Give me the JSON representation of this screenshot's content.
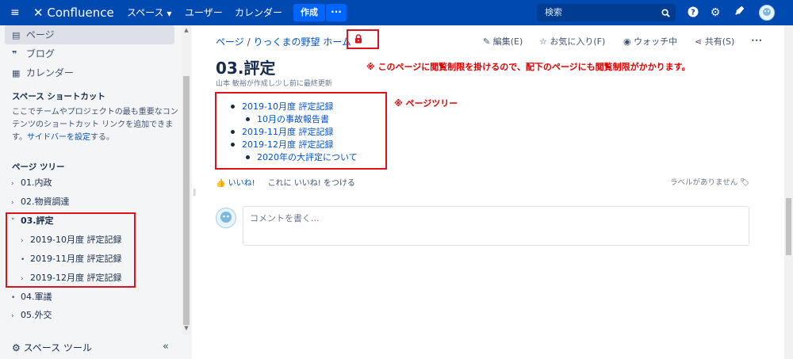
{
  "topbar": {
    "app_name": "Confluence",
    "nav": [
      "スペース",
      "ユーザー",
      "カレンダー"
    ],
    "create": "作成",
    "more": "···",
    "search_placeholder": "検索"
  },
  "sidebar": {
    "items": [
      {
        "icon": "page-icon",
        "label": "ページ"
      },
      {
        "icon": "blog-icon",
        "label": "ブログ"
      },
      {
        "icon": "calendar-icon",
        "label": "カレンダー"
      }
    ],
    "shortcut_heading": "スペース ショートカット",
    "shortcut_text": "ここでチームやプロジェクトの最も重要なコンテンツのショートカット リンクを追加できます。",
    "shortcut_link": "サイドバーを設定",
    "shortcut_tail": "する。",
    "tree_heading": "ページ ツリー",
    "tree": [
      {
        "label": "01.内政",
        "level": 0,
        "marker": "chevron"
      },
      {
        "label": "02.物資調達",
        "level": 0,
        "marker": "chevron"
      },
      {
        "label": "03.評定",
        "level": 0,
        "marker": "open",
        "current": true
      },
      {
        "label": "2019-10月度 評定記録",
        "level": 1,
        "marker": "chevron"
      },
      {
        "label": "2019-11月度 評定記録",
        "level": 1,
        "marker": "dot"
      },
      {
        "label": "2019-12月度 評定記録",
        "level": 1,
        "marker": "chevron"
      },
      {
        "label": "04.軍議",
        "level": 0,
        "marker": "dot"
      },
      {
        "label": "05.外交",
        "level": 0,
        "marker": "chevron"
      }
    ],
    "space_tools": "スペース ツール",
    "collapse": "«"
  },
  "breadcrumb": {
    "root": "ページ",
    "sep": " / ",
    "parent": "りっくまの野望 ホーム"
  },
  "actions": {
    "edit": "編集(E)",
    "favorite": "お気に入り(F)",
    "watch": "ウォッチ中",
    "share": "共有(S)",
    "more": "•••"
  },
  "page": {
    "title": "03.評定",
    "byline": "山本 敏裕が作成し少し前に最終更新",
    "notice_restriction": "※ このページに閲覧制限を掛けるので、配下のページにも閲覧制限がかかります。",
    "notice_tree": "※ ページツリー",
    "children": [
      {
        "label": "2019-10月度 評定記録",
        "level": 0
      },
      {
        "label": "10月の事故報告書",
        "level": 1
      },
      {
        "label": "2019-11月度 評定記録",
        "level": 0
      },
      {
        "label": "2019-12月度 評定記録",
        "level": 0
      },
      {
        "label": "2020年の大評定について",
        "level": 1
      }
    ],
    "like": "いいね!",
    "like_prompt": "これに いいね! をつける",
    "no_labels": "ラベルがありません",
    "comment_placeholder": "コメントを書く..."
  },
  "colors": {
    "topbar": "#0049b0",
    "link": "#0052cc",
    "annotation": "#e00000",
    "box": "#d9141e"
  }
}
